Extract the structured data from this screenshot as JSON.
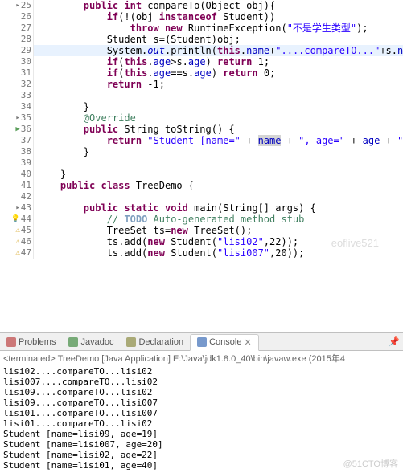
{
  "editor": {
    "lines": [
      {
        "num": "25",
        "icons": [
          "tri"
        ],
        "indent": "        ",
        "tokens": [
          {
            "t": "public",
            "c": "kw"
          },
          {
            "t": " "
          },
          {
            "t": "int",
            "c": "kw"
          },
          {
            "t": " compareTo(Object obj){"
          }
        ]
      },
      {
        "num": "26",
        "icons": [],
        "indent": "            ",
        "tokens": [
          {
            "t": "if",
            "c": "kw"
          },
          {
            "t": "(!(obj "
          },
          {
            "t": "instanceof",
            "c": "kw"
          },
          {
            "t": " Student))"
          }
        ]
      },
      {
        "num": "27",
        "icons": [],
        "indent": "                ",
        "tokens": [
          {
            "t": "throw",
            "c": "kw"
          },
          {
            "t": " "
          },
          {
            "t": "new",
            "c": "kw"
          },
          {
            "t": " RuntimeException("
          },
          {
            "t": "\"不是学生类型\"",
            "c": "str"
          },
          {
            "t": ");"
          }
        ]
      },
      {
        "num": "28",
        "icons": [],
        "indent": "            ",
        "tokens": [
          {
            "t": "Student s=(Student)obj;"
          }
        ]
      },
      {
        "num": "29",
        "icons": [],
        "hl": true,
        "indent": "            ",
        "tokens": [
          {
            "t": "System."
          },
          {
            "t": "out",
            "c": "sta"
          },
          {
            "t": ".println("
          },
          {
            "t": "this",
            "c": "kw"
          },
          {
            "t": "."
          },
          {
            "t": "name",
            "c": "fld"
          },
          {
            "t": "+"
          },
          {
            "t": "\"....compareTO...\"",
            "c": "str"
          },
          {
            "t": "+s."
          },
          {
            "t": "name",
            "c": "fld"
          },
          {
            "t": ");",
            "cur": true
          }
        ]
      },
      {
        "num": "30",
        "icons": [],
        "indent": "            ",
        "tokens": [
          {
            "t": "if",
            "c": "kw"
          },
          {
            "t": "("
          },
          {
            "t": "this",
            "c": "kw"
          },
          {
            "t": "."
          },
          {
            "t": "age",
            "c": "fld"
          },
          {
            "t": ">s."
          },
          {
            "t": "age",
            "c": "fld"
          },
          {
            "t": ") "
          },
          {
            "t": "return",
            "c": "kw"
          },
          {
            "t": " 1;"
          }
        ]
      },
      {
        "num": "31",
        "icons": [],
        "indent": "            ",
        "tokens": [
          {
            "t": "if",
            "c": "kw"
          },
          {
            "t": "("
          },
          {
            "t": "this",
            "c": "kw"
          },
          {
            "t": "."
          },
          {
            "t": "age",
            "c": "fld"
          },
          {
            "t": "==s."
          },
          {
            "t": "age",
            "c": "fld"
          },
          {
            "t": ") "
          },
          {
            "t": "return",
            "c": "kw"
          },
          {
            "t": " 0;"
          }
        ]
      },
      {
        "num": "32",
        "icons": [],
        "indent": "            ",
        "tokens": [
          {
            "t": "return",
            "c": "kw"
          },
          {
            "t": " -1;"
          }
        ]
      },
      {
        "num": "33",
        "icons": [],
        "indent": "",
        "tokens": []
      },
      {
        "num": "34",
        "icons": [],
        "indent": "        ",
        "tokens": [
          {
            "t": "}"
          }
        ]
      },
      {
        "num": "35",
        "icons": [
          "tri"
        ],
        "indent": "        ",
        "tokens": [
          {
            "t": "@Override",
            "c": "cmt"
          }
        ]
      },
      {
        "num": "36",
        "icons": [
          "arr"
        ],
        "indent": "        ",
        "tokens": [
          {
            "t": "public",
            "c": "kw"
          },
          {
            "t": " String toString() {"
          }
        ]
      },
      {
        "num": "37",
        "icons": [],
        "indent": "            ",
        "tokens": [
          {
            "t": "return",
            "c": "kw"
          },
          {
            "t": " "
          },
          {
            "t": "\"Student [name=\"",
            "c": "str"
          },
          {
            "t": " + "
          },
          {
            "t": "name",
            "c": "fld",
            "bg": true
          },
          {
            "t": " + "
          },
          {
            "t": "\", age=\"",
            "c": "str"
          },
          {
            "t": " + "
          },
          {
            "t": "age",
            "c": "fld"
          },
          {
            "t": " + "
          },
          {
            "t": "\"]\"",
            "c": "str"
          },
          {
            "t": ";"
          }
        ]
      },
      {
        "num": "38",
        "icons": [],
        "indent": "        ",
        "tokens": [
          {
            "t": "}"
          }
        ]
      },
      {
        "num": "39",
        "icons": [],
        "indent": "",
        "tokens": []
      },
      {
        "num": "40",
        "icons": [],
        "indent": "    ",
        "tokens": [
          {
            "t": "}"
          }
        ]
      },
      {
        "num": "41",
        "icons": [],
        "indent": "    ",
        "tokens": [
          {
            "t": "public",
            "c": "kw"
          },
          {
            "t": " "
          },
          {
            "t": "class",
            "c": "kw"
          },
          {
            "t": " "
          },
          {
            "t": "TreeDemo",
            "c": "cls"
          },
          {
            "t": " {"
          }
        ]
      },
      {
        "num": "42",
        "icons": [],
        "indent": "",
        "tokens": []
      },
      {
        "num": "43",
        "icons": [
          "tri"
        ],
        "indent": "        ",
        "tokens": [
          {
            "t": "public",
            "c": "kw"
          },
          {
            "t": " "
          },
          {
            "t": "static",
            "c": "kw"
          },
          {
            "t": " "
          },
          {
            "t": "void",
            "c": "kw"
          },
          {
            "t": " main(String[] args) {"
          }
        ]
      },
      {
        "num": "44",
        "icons": [
          "bulb"
        ],
        "indent": "            ",
        "tokens": [
          {
            "t": "// ",
            "c": "cmt"
          },
          {
            "t": "TODO",
            "c": "todo"
          },
          {
            "t": " Auto-generated method stub",
            "c": "cmt"
          }
        ]
      },
      {
        "num": "45",
        "icons": [
          "warn"
        ],
        "indent": "            ",
        "tokens": [
          {
            "t": "TreeSet ts="
          },
          {
            "t": "new",
            "c": "kw"
          },
          {
            "t": " TreeSet();"
          }
        ]
      },
      {
        "num": "46",
        "icons": [
          "warn"
        ],
        "indent": "            ",
        "tokens": [
          {
            "t": "ts.add("
          },
          {
            "t": "new",
            "c": "kw"
          },
          {
            "t": " Student("
          },
          {
            "t": "\"lisi02\"",
            "c": "str"
          },
          {
            "t": ",22));"
          }
        ]
      },
      {
        "num": "47",
        "icons": [
          "warn"
        ],
        "indent": "            ",
        "tokens": [
          {
            "t": "ts.add("
          },
          {
            "t": "new",
            "c": "kw"
          },
          {
            "t": " Student("
          },
          {
            "t": "\"lisi007\"",
            "c": "str"
          },
          {
            "t": ",20));"
          }
        ]
      }
    ]
  },
  "tabs": {
    "items": [
      {
        "label": "Problems",
        "active": false
      },
      {
        "label": "Javadoc",
        "active": false
      },
      {
        "label": "Declaration",
        "active": false
      },
      {
        "label": "Console",
        "active": true,
        "close": true
      }
    ]
  },
  "console": {
    "header": "<terminated> TreeDemo [Java Application] E:\\Java\\jdk1.8.0_40\\bin\\javaw.exe (2015年4",
    "lines": [
      "lisi02....compareTO...lisi02",
      "lisi007....compareTO...lisi02",
      "lisi09....compareTO...lisi02",
      "lisi09....compareTO...lisi007",
      "lisi01....compareTO...lisi007",
      "lisi01....compareTO...lisi02",
      "Student [name=lisi09, age=19]",
      "Student [name=lisi007, age=20]",
      "Student [name=lisi02, age=22]",
      "Student [name=lisi01, age=40]"
    ]
  },
  "watermark": "@51CTO博客",
  "watermark2": "eoflive521"
}
